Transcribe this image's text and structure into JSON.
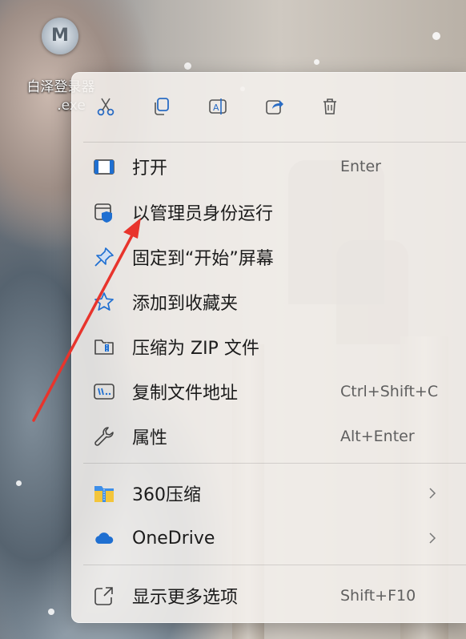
{
  "desktop": {
    "icon_name_line1": "白泽登录器",
    "icon_name_line2": ".exe",
    "logo_letter": "M"
  },
  "toolbar": {
    "buttons": [
      {
        "icon": "scissors-icon",
        "action": "cut"
      },
      {
        "icon": "copy-icon",
        "action": "copy"
      },
      {
        "icon": "rename-icon",
        "action": "rename"
      },
      {
        "icon": "share-icon",
        "action": "share"
      },
      {
        "icon": "trash-icon",
        "action": "delete"
      }
    ]
  },
  "menu": {
    "items": [
      {
        "label": "打开",
        "shortcut": "Enter",
        "icon": "open-app-icon"
      },
      {
        "label": "以管理员身份运行",
        "shortcut": "",
        "icon": "shield-admin-icon"
      },
      {
        "label": "固定到“开始”屏幕",
        "shortcut": "",
        "icon": "pin-icon"
      },
      {
        "label": "添加到收藏夹",
        "shortcut": "",
        "icon": "star-icon"
      },
      {
        "label": "压缩为 ZIP 文件",
        "shortcut": "",
        "icon": "zip-icon"
      },
      {
        "label": "复制文件地址",
        "shortcut": "Ctrl+Shift+C",
        "icon": "copy-path-icon"
      },
      {
        "label": "属性",
        "shortcut": "Alt+Enter",
        "icon": "wrench-icon"
      }
    ],
    "submenus": [
      {
        "label": "360压缩",
        "icon": "360-zip-icon"
      },
      {
        "label": "OneDrive",
        "icon": "onedrive-cloud-icon"
      }
    ],
    "more": {
      "label": "显示更多选项",
      "shortcut": "Shift+F10",
      "icon": "more-options-icon"
    }
  },
  "colors": {
    "accent": "#1f6fd1",
    "arrow": "#e8342c",
    "menu_bg": "#f4f1ee"
  }
}
